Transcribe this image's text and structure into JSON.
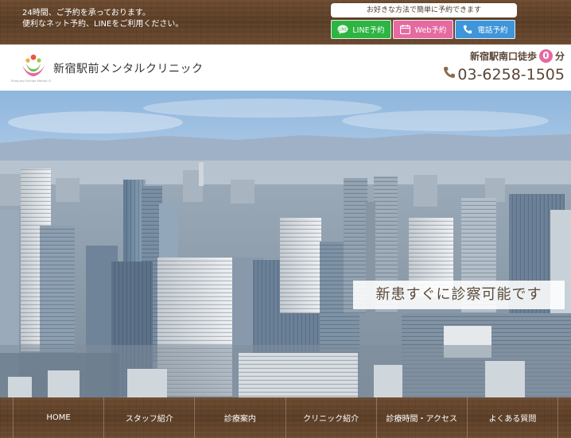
{
  "topbar": {
    "notice_line1": "24時間、ご予約を承っております。",
    "notice_line2": "便利なネット予約、LINEをご利用ください。",
    "reserve_caption": "お好きな方法で簡単に予約できます",
    "buttons": [
      {
        "label": "LINE予約",
        "icon": "line-chat-icon",
        "color": "#2db442"
      },
      {
        "label": "Web予約",
        "icon": "calendar-icon",
        "color": "#e56aa0"
      },
      {
        "label": "電話予約",
        "icon": "phone-icon",
        "color": "#3e95da"
      }
    ]
  },
  "header": {
    "logo_subtext": "Shinjuku Ekimae Mental Cl",
    "title": "新宿駅前メンタルクリニック",
    "walk_prefix": "新宿駅南口徒歩",
    "walk_minutes": "0",
    "walk_suffix": "分",
    "phone": "03-6258-1505"
  },
  "hero": {
    "image": "tokyo-skyline-photo",
    "tagline": "新患すぐに診察可能です"
  },
  "nav": {
    "items": [
      "HOME",
      "スタッフ紹介",
      "診療案内",
      "クリニック紹介",
      "診療時間・アクセス",
      "よくある質問"
    ]
  },
  "colors": {
    "wood": "#5a3d25",
    "line": "#2db442",
    "web": "#e56aa0",
    "tel": "#3e95da",
    "brown_text": "#5b4636"
  }
}
